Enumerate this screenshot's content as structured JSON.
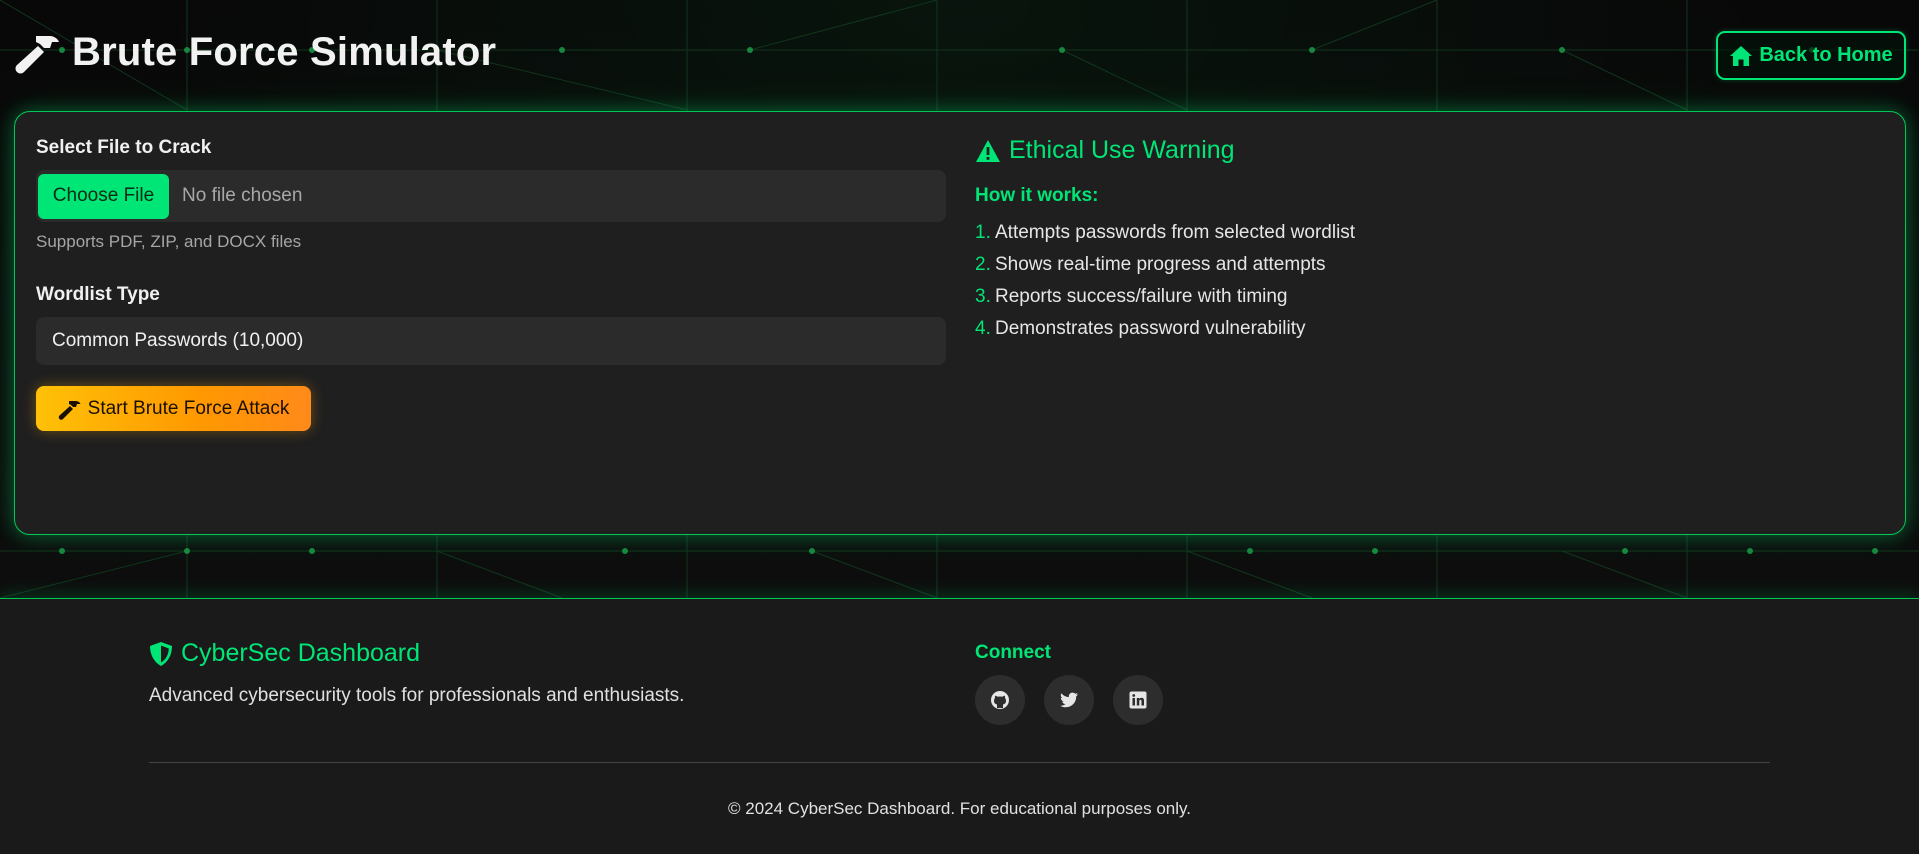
{
  "header": {
    "title": "Brute Force Simulator",
    "home_button": "Back to Home"
  },
  "form": {
    "file_label": "Select File to Crack",
    "choose_button": "Choose File",
    "file_status": "No file chosen",
    "file_hint": "Supports PDF, ZIP, and DOCX files",
    "wordlist_label": "Wordlist Type",
    "wordlist_selected": "Common Passwords (10,000)",
    "start_button": "Start Brute Force Attack"
  },
  "warning": {
    "title": "Ethical Use Warning",
    "how_label": "How it works:",
    "steps": [
      {
        "num": "1.",
        "text": "Attempts passwords from selected wordlist"
      },
      {
        "num": "2.",
        "text": "Shows real-time progress and attempts"
      },
      {
        "num": "3.",
        "text": "Reports success/failure with timing"
      },
      {
        "num": "4.",
        "text": "Demonstrates password vulnerability"
      }
    ]
  },
  "footer": {
    "brand": "CyberSec Dashboard",
    "tagline": "Advanced cybersecurity tools for professionals and enthusiasts.",
    "connect_label": "Connect",
    "socials": [
      "github-icon",
      "twitter-icon",
      "linkedin-icon"
    ],
    "copyright": "© 2024 CyberSec Dashboard. For educational purposes only."
  },
  "colors": {
    "accent": "#00e676",
    "warning_gradient_start": "#ffc107",
    "warning_gradient_end": "#ff8a1a",
    "background": "#0c0c0c",
    "card": "#1f1f1f"
  }
}
